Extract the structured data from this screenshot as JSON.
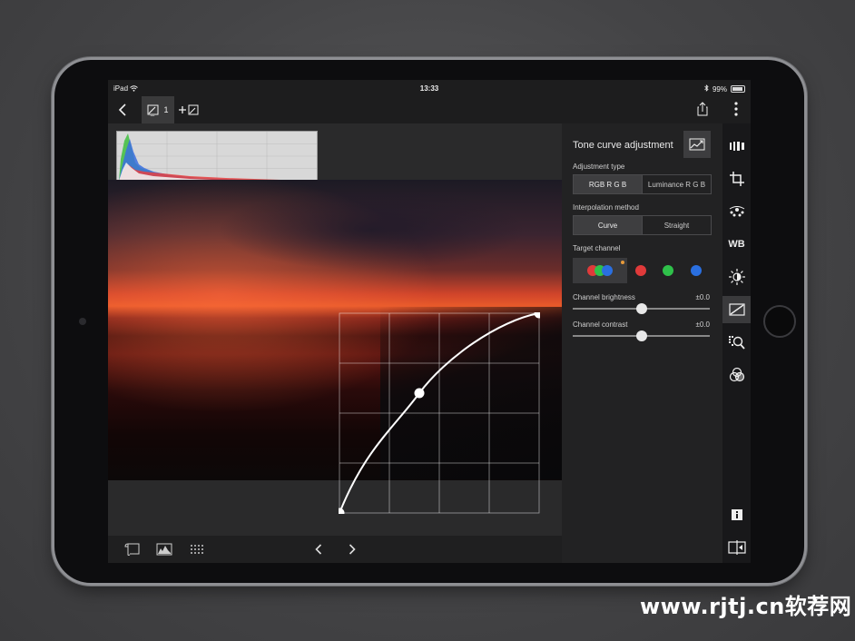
{
  "status": {
    "device": "iPad",
    "time": "13:33",
    "battery": "99%"
  },
  "toolbar": {
    "image_index": "1"
  },
  "panel": {
    "title": "Tone curve adjustment",
    "adjustment_type": {
      "label": "Adjustment type",
      "options": [
        "RGB R G B",
        "Luminance R G B"
      ],
      "selected": "RGB R G B"
    },
    "interpolation": {
      "label": "Interpolation method",
      "options": [
        "Curve",
        "Straight"
      ],
      "selected": "Curve"
    },
    "target_channel": {
      "label": "Target channel",
      "channels": [
        "RGB",
        "Red",
        "Green",
        "Blue"
      ],
      "selected": "RGB"
    },
    "brightness": {
      "label": "Channel brightness",
      "value": "±0.0",
      "level": 0.5
    },
    "contrast": {
      "label": "Channel contrast",
      "value": "±0.0",
      "level": 0.5
    }
  },
  "rail": {
    "wb_label": "WB"
  },
  "colors": {
    "red": "#e03a3a",
    "green": "#2fc14a",
    "blue": "#2a6fe0"
  },
  "curve": {
    "points": [
      [
        0,
        0
      ],
      [
        0.4,
        0.6
      ],
      [
        1,
        1
      ]
    ]
  },
  "watermark": "www.rjtj.cn软荐网"
}
